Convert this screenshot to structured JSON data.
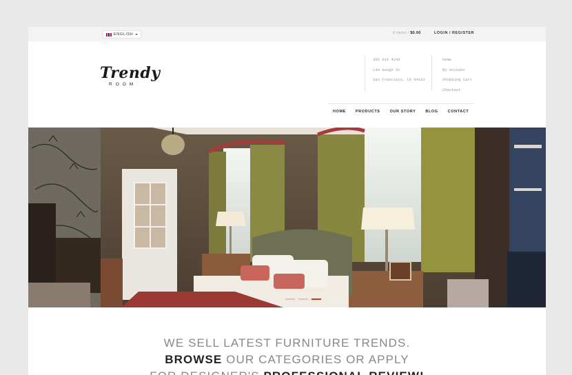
{
  "topbar": {
    "language": "ENGLISH",
    "cart_items": "0 items /",
    "cart_total": "$0.00",
    "login_register": "LOGIN / REGISTER"
  },
  "logo": {
    "script": "Trendy",
    "sub": "ROOM"
  },
  "contact": {
    "lines": [
      "365 916 4245",
      "149 Gough St",
      "San Francisco, CA 94102"
    ]
  },
  "quick_links": [
    "Home",
    "My Account",
    "Shopping Cart",
    "Checkout"
  ],
  "nav": [
    "HOME",
    "PRODUCTS",
    "OUR STORY",
    "BLOG",
    "CONTACT"
  ],
  "slider": {
    "slide_count": 3,
    "active_index": 2
  },
  "tagline": {
    "line1": "WE SELL LATEST FURNITURE TRENDS.",
    "line2_bold": "BROWSE",
    "line2_rest": " OUR CATEGORIES OR APPLY",
    "line3_start": "FOR DESIGNER'S ",
    "line3_bold": "PROFESSIONAL REVIEW!"
  },
  "colors": {
    "page_bg": "#e9e9e9",
    "topbar_bg": "#f3f3f3",
    "accent": "#c0392b"
  }
}
